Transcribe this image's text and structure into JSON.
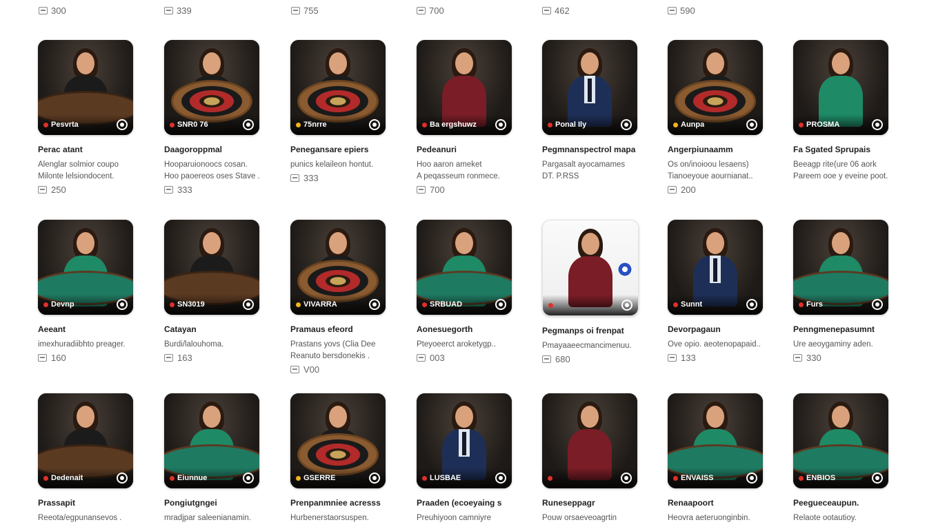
{
  "top_row": [
    {
      "count": "300"
    },
    {
      "count": "339"
    },
    {
      "count": "755"
    },
    {
      "count": "700"
    },
    {
      "count": "462"
    },
    {
      "count": "590"
    }
  ],
  "rows": [
    [
      {
        "badge": "Pesvrta",
        "title": "Perac atant",
        "desc": [
          "Alenglar solmior coupo",
          "Milonte lelsiondocent."
        ],
        "count": "250"
      },
      {
        "badge": "SNR0 76",
        "title": "Daagoroppmal",
        "desc": [
          "Hooparuionoocs cosan.",
          "Hoo paoereos oses Stave ."
        ],
        "count": "333"
      },
      {
        "badge": "75nrre",
        "title": "Penegansare epiers",
        "desc": [
          "punics kelaileon hontut."
        ],
        "count": "333"
      },
      {
        "badge": "Ba ergshuwz",
        "title": "Pedeanuri",
        "desc": [
          "Hoo aaron ameket",
          "A peqasseum ronmece."
        ],
        "count": "700"
      },
      {
        "badge": "Ponal Ily",
        "title": "Pegmnanspectrol mapa",
        "desc": [
          "Pargasalt ayocamames",
          "DT. P.RSS"
        ],
        "count": ""
      },
      {
        "badge": "Aunpa",
        "title": "Angerpiunaamm",
        "desc": [
          "Os on/inoioou lesaens)",
          "Tianoeyoue aournianat.."
        ],
        "count": "200"
      },
      {
        "badge": "PROSMA",
        "title": "Fa Sgated Sprupais",
        "desc": [
          "Beeagp rite(ure 06 aork",
          "Pareem ooe y eveine poot."
        ],
        "count": ""
      }
    ],
    [
      {
        "badge": "Devnp",
        "title": "Aeeant",
        "desc": [
          "imexhuradiibhto preager."
        ],
        "count": "160"
      },
      {
        "badge": "SN3019",
        "title": "Catayan",
        "desc": [
          "Burdi/lalouhoma."
        ],
        "count": "163"
      },
      {
        "badge": "VIVARRA",
        "title": "Pramaus efeord",
        "desc": [
          "Prastans yovs (Clia Dee",
          "Reanuto bersdonekis ."
        ],
        "count": "V00"
      },
      {
        "badge": "SRBUAD",
        "title": "Aonesuegorth",
        "desc": [
          "Pteyoeerct aroketygp.."
        ],
        "count": "003"
      },
      {
        "badge": "",
        "title": "Pegmanps oi frenpat",
        "desc": [
          "Pmayaaeecmancimenuu."
        ],
        "count": "680"
      },
      {
        "badge": "Sunnt",
        "title": "Devorpagaun",
        "desc": [
          "Ove opio. aeotenopapaid.."
        ],
        "count": "133"
      },
      {
        "badge": "Furs",
        "title": "Penngmenepasumnt",
        "desc": [
          "Ure aeoygaminy aden."
        ],
        "count": "330"
      }
    ],
    [
      {
        "badge": "Dedenait",
        "title": "Prassapit",
        "desc": [
          "Reeota/egpunansevos ."
        ],
        "count": ""
      },
      {
        "badge": "Eiunnue",
        "title": "Pongiutgngei",
        "desc": [
          "mradjpar saleenianamin."
        ],
        "count": ""
      },
      {
        "badge": "GSERRE",
        "title": "Prenpanmniee acresss",
        "desc": [
          "Hurbenerstaorsuspen."
        ],
        "count": ""
      },
      {
        "badge": "LUSBAE",
        "title": "Praaden (ecoeyaing s",
        "desc": [
          "Preuhiyoon camniyre"
        ],
        "count": ""
      },
      {
        "badge": "",
        "title": "Runeseppagr",
        "desc": [
          "Pouw orsaeveoagrtin"
        ],
        "count": ""
      },
      {
        "badge": "ENVAISS",
        "title": "Renaapoort",
        "desc": [
          "Heovra aeteruonginbin."
        ],
        "count": ""
      },
      {
        "badge": "ENBIOS",
        "title": "Peegueceaupun.",
        "desc": [
          "Relaote ootautioy."
        ],
        "count": ""
      }
    ]
  ],
  "colors": {
    "accent_red": "#e0302a",
    "accent_gold": "#f2b41c",
    "felt": "#1f7a62",
    "wood": "#5b3a22"
  },
  "icons": {
    "play": "play-circle-icon",
    "count": "viewers-icon"
  }
}
